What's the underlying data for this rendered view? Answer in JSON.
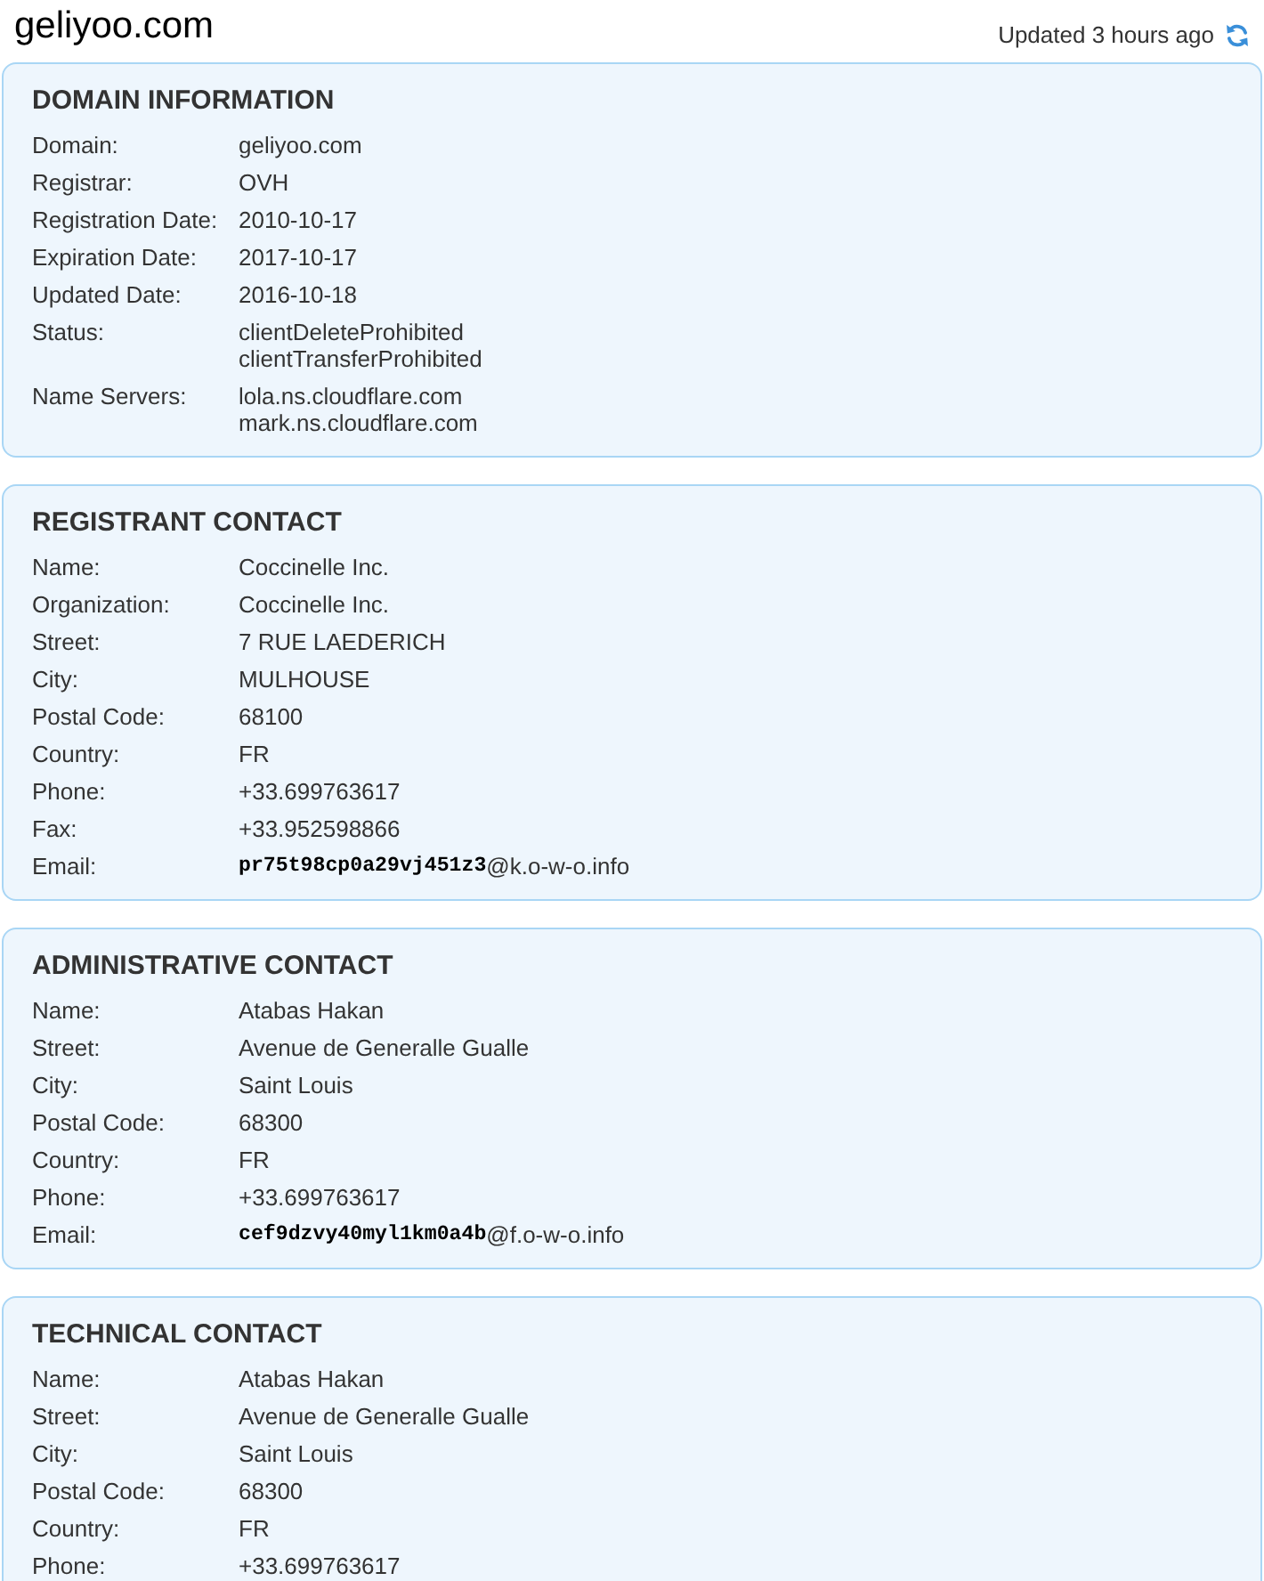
{
  "header": {
    "title": "geliyoo.com",
    "updated": "Updated 3 hours ago"
  },
  "sections": [
    {
      "title": "DOMAIN INFORMATION",
      "rows": [
        {
          "kind": "text",
          "label": "Domain:",
          "lines": [
            "geliyoo.com"
          ]
        },
        {
          "kind": "text",
          "label": "Registrar:",
          "lines": [
            "OVH"
          ]
        },
        {
          "kind": "text",
          "label": "Registration Date:",
          "lines": [
            "2010-10-17"
          ]
        },
        {
          "kind": "text",
          "label": "Expiration Date:",
          "lines": [
            "2017-10-17"
          ]
        },
        {
          "kind": "text",
          "label": "Updated Date:",
          "lines": [
            "2016-10-18"
          ]
        },
        {
          "kind": "text",
          "label": "Status:",
          "lines": [
            "clientDeleteProhibited",
            "clientTransferProhibited"
          ]
        },
        {
          "kind": "text",
          "label": "Name Servers:",
          "lines": [
            "lola.ns.cloudflare.com",
            "mark.ns.cloudflare.com"
          ]
        }
      ]
    },
    {
      "title": "REGISTRANT CONTACT",
      "rows": [
        {
          "kind": "text",
          "label": "Name:",
          "lines": [
            "Coccinelle Inc."
          ]
        },
        {
          "kind": "text",
          "label": "Organization:",
          "lines": [
            "Coccinelle Inc."
          ]
        },
        {
          "kind": "text",
          "label": "Street:",
          "lines": [
            "7 RUE LAEDERICH"
          ]
        },
        {
          "kind": "text",
          "label": "City:",
          "lines": [
            "MULHOUSE"
          ]
        },
        {
          "kind": "text",
          "label": "Postal Code:",
          "lines": [
            "68100"
          ]
        },
        {
          "kind": "text",
          "label": "Country:",
          "lines": [
            "FR"
          ]
        },
        {
          "kind": "text",
          "label": "Phone:",
          "lines": [
            "+33.699763617"
          ]
        },
        {
          "kind": "text",
          "label": "Fax:",
          "lines": [
            "+33.952598866"
          ]
        },
        {
          "kind": "email",
          "label": "Email:",
          "user": "pr75t98cp0a29vj451z3",
          "domain": "@k.o-w-o.info"
        }
      ]
    },
    {
      "title": "ADMINISTRATIVE CONTACT",
      "rows": [
        {
          "kind": "text",
          "label": "Name:",
          "lines": [
            "Atabas Hakan"
          ]
        },
        {
          "kind": "text",
          "label": "Street:",
          "lines": [
            "Avenue de Generalle Gualle"
          ]
        },
        {
          "kind": "text",
          "label": "City:",
          "lines": [
            "Saint Louis"
          ]
        },
        {
          "kind": "text",
          "label": "Postal Code:",
          "lines": [
            "68300"
          ]
        },
        {
          "kind": "text",
          "label": "Country:",
          "lines": [
            "FR"
          ]
        },
        {
          "kind": "text",
          "label": "Phone:",
          "lines": [
            "+33.699763617"
          ]
        },
        {
          "kind": "email",
          "label": "Email:",
          "user": "cef9dzvy40myl1km0a4b",
          "domain": "@f.o-w-o.info"
        }
      ]
    },
    {
      "title": "TECHNICAL CONTACT",
      "rows": [
        {
          "kind": "text",
          "label": "Name:",
          "lines": [
            "Atabas Hakan"
          ]
        },
        {
          "kind": "text",
          "label": "Street:",
          "lines": [
            "Avenue de Generalle Gualle"
          ]
        },
        {
          "kind": "text",
          "label": "City:",
          "lines": [
            "Saint Louis"
          ]
        },
        {
          "kind": "text",
          "label": "Postal Code:",
          "lines": [
            "68300"
          ]
        },
        {
          "kind": "text",
          "label": "Country:",
          "lines": [
            "FR"
          ]
        },
        {
          "kind": "text",
          "label": "Phone:",
          "lines": [
            "+33.699763617"
          ]
        }
      ]
    }
  ]
}
